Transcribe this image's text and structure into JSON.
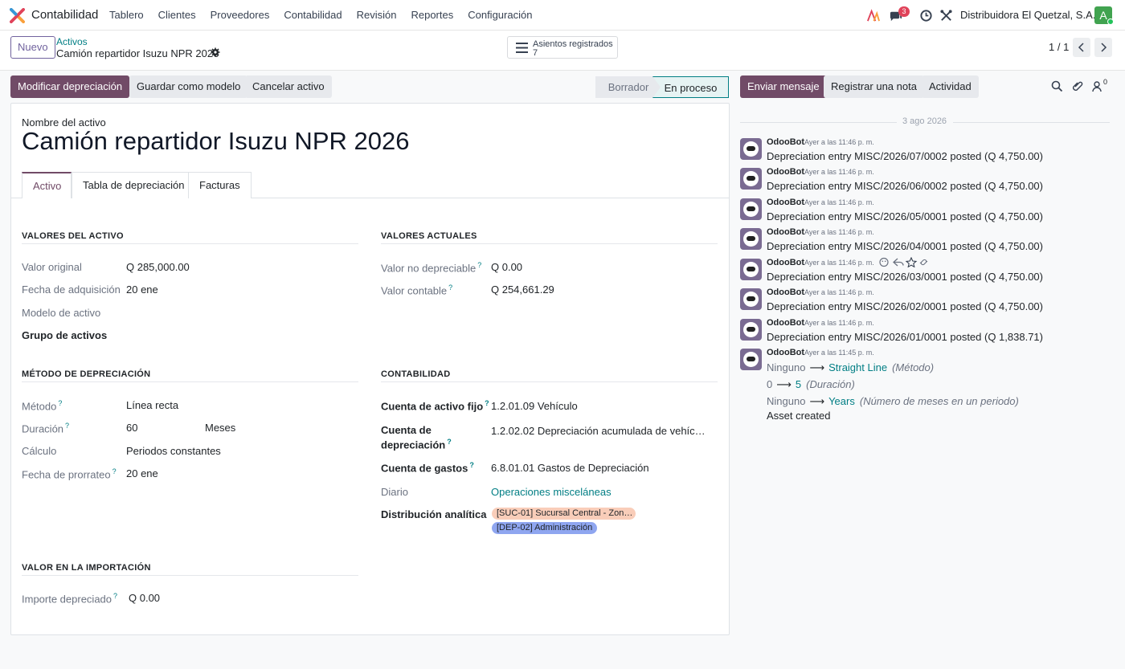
{
  "app": {
    "name": "Contabilidad"
  },
  "menu": [
    "Tablero",
    "Clientes",
    "Proveedores",
    "Contabilidad",
    "Revisión",
    "Reportes",
    "Configuración"
  ],
  "systray": {
    "chat_badge": "3",
    "company": "Distribuidora El Quetzal, S.A.",
    "avatar_initial": "A",
    "avatar_color": "#41a350"
  },
  "control": {
    "new_label": "Nuevo",
    "breadcrumb_parent": "Activos",
    "breadcrumb_current": "Camión repartidor Isuzu NPR 2026",
    "smart_label": "Asientos registrados",
    "smart_value": "7",
    "pager": "1 / 1"
  },
  "actions": {
    "modify": "Modificar depreciación",
    "save_model": "Guardar como modelo",
    "cancel": "Cancelar activo"
  },
  "status": {
    "draft": "Borrador",
    "running": "En proceso"
  },
  "form": {
    "name_label": "Nombre del activo",
    "name": "Camión repartidor Isuzu NPR 2026",
    "tabs": [
      "Activo",
      "Tabla de depreciación",
      "Facturas"
    ],
    "asset_values": {
      "title": "VALORES DEL ACTIVO",
      "original_label": "Valor original",
      "original": "Q 285,000.00",
      "acq_label": "Fecha de adquisición",
      "acq": "20 ene",
      "model_label": "Modelo de activo",
      "group_label": "Grupo de activos"
    },
    "current_values": {
      "title": "VALORES ACTUALES",
      "salvage_label": "Valor no depreciable",
      "salvage": "Q 0.00",
      "book_label": "Valor contable",
      "book": "Q 254,661.29"
    },
    "method": {
      "title": "MÉTODO DE DEPRECIACIÓN",
      "method_label": "Método",
      "method": "Línea recta",
      "duration_label": "Duración",
      "duration": "60",
      "duration_unit": "Meses",
      "compute_label": "Cálculo",
      "compute": "Periodos constantes",
      "prorata_label": "Fecha de prorrateo",
      "prorata": "20 ene"
    },
    "accounting": {
      "title": "CONTABILIDAD",
      "fixed_label": "Cuenta de activo fijo",
      "fixed": "1.2.01.09 Vehículo",
      "dep_label_1": "Cuenta de",
      "dep_label_2": "depreciación",
      "dep": "1.2.02.02 Depreciación acumulada de vehíc…",
      "exp_label": "Cuenta de gastos",
      "exp": "6.8.01.01 Gastos de Depreciación",
      "journal_label": "Diario",
      "journal": "Operaciones misceláneas",
      "analytic_label": "Distribución analítica",
      "tag1": "[SUC-01] Sucursal Central - Zon…",
      "tag2": "[DEP-02] Administración"
    },
    "import": {
      "title": "VALOR EN LA IMPORTACIÓN",
      "dep_label": "Importe depreciado",
      "dep": "Q 0.00"
    }
  },
  "chatter": {
    "send": "Enviar mensaje",
    "note": "Registrar una nota",
    "activity": "Actividad",
    "followers": "0",
    "date": "3 ago 2026",
    "messages": [
      {
        "author": "OdooBot",
        "time": "Ayer a las 11:46 p. m.",
        "body": "Depreciation entry MISC/2026/07/0002 posted (Q 4,750.00)"
      },
      {
        "author": "OdooBot",
        "time": "Ayer a las 11:46 p. m.",
        "body": "Depreciation entry MISC/2026/06/0002 posted (Q 4,750.00)"
      },
      {
        "author": "OdooBot",
        "time": "Ayer a las 11:46 p. m.",
        "body": "Depreciation entry MISC/2026/05/0001 posted (Q 4,750.00)"
      },
      {
        "author": "OdooBot",
        "time": "Ayer a las 11:46 p. m.",
        "body": "Depreciation entry MISC/2026/04/0001 posted (Q 4,750.00)"
      },
      {
        "author": "OdooBot",
        "time": "Ayer a las 11:46 p. m.",
        "body": "Depreciation entry MISC/2026/03/0001 posted (Q 4,750.00)"
      },
      {
        "author": "OdooBot",
        "time": "Ayer a las 11:46 p. m.",
        "body": "Depreciation entry MISC/2026/02/0001 posted (Q 4,750.00)"
      },
      {
        "author": "OdooBot",
        "time": "Ayer a las 11:46 p. m.",
        "body": "Depreciation entry MISC/2026/01/0001 posted (Q 1,838.71)"
      },
      {
        "author": "OdooBot",
        "time": "Ayer a las 11:45 p. m.",
        "body": ""
      }
    ],
    "tracking": [
      {
        "old": "Ninguno",
        "new": "Straight Line",
        "field": "(Método)"
      },
      {
        "old": "0",
        "new": "5",
        "field": "(Duración)"
      },
      {
        "old": "Ninguno",
        "new": "Years",
        "field": "(Número de meses en un periodo)"
      }
    ],
    "created": "Asset created"
  }
}
